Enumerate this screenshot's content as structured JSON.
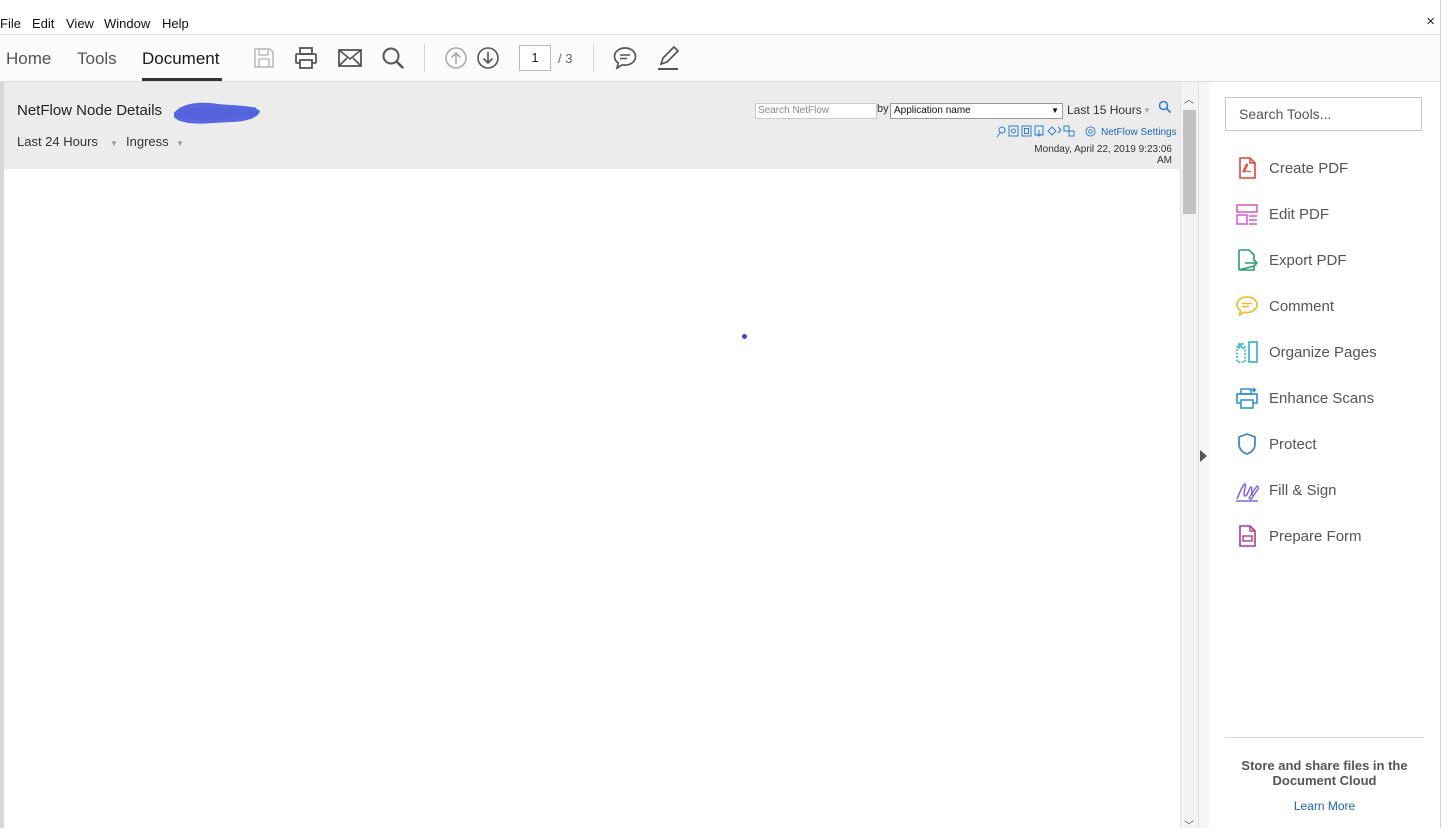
{
  "menubar": {
    "items": [
      "File",
      "Edit",
      "View",
      "Window",
      "Help"
    ],
    "close_label": "×"
  },
  "toolbar": {
    "tabs": [
      "Home",
      "Tools",
      "Document"
    ],
    "active_tab": "Document",
    "page_current": "1",
    "page_total": "/ 3",
    "icons": [
      "save-icon",
      "print-icon",
      "email-icon",
      "search-icon",
      "page-up-icon",
      "page-down-icon",
      "comment-icon",
      "highlight-pen-icon"
    ]
  },
  "netflow": {
    "title": "NetFlow Node Details",
    "filters": [
      "Last 24 Hours",
      "Ingress"
    ],
    "search_placeholder": "Search NetFlow",
    "by_label": "by",
    "search_by": "Application name",
    "period": "Last 15 Hours",
    "settings_label": "NetFlow Settings",
    "timestamp": "Monday, April 22, 2019 9:23:06 AM"
  },
  "tools_pane": {
    "search_placeholder": "Search Tools...",
    "items": [
      {
        "label": "Create PDF",
        "icon": "create-pdf-icon",
        "color": "#e0463c"
      },
      {
        "label": "Edit PDF",
        "icon": "edit-pdf-icon",
        "color": "#d856c8"
      },
      {
        "label": "Export PDF",
        "icon": "export-pdf-icon",
        "color": "#2a9d6e"
      },
      {
        "label": "Comment",
        "icon": "comment-icon",
        "color": "#f2b824"
      },
      {
        "label": "Organize Pages",
        "icon": "organize-pages-icon",
        "color": "#2bb3c9"
      },
      {
        "label": "Enhance Scans",
        "icon": "enhance-scans-icon",
        "color": "#2a8fd6"
      },
      {
        "label": "Protect",
        "icon": "protect-icon",
        "color": "#3a7fd6"
      },
      {
        "label": "Fill & Sign",
        "icon": "fill-sign-icon",
        "color": "#7e67d8"
      },
      {
        "label": "Prepare Form",
        "icon": "prepare-form-icon",
        "color": "#b23a8c"
      }
    ],
    "cloud_text": "Store and share files in the Document Cloud",
    "learn_more": "Learn More"
  }
}
